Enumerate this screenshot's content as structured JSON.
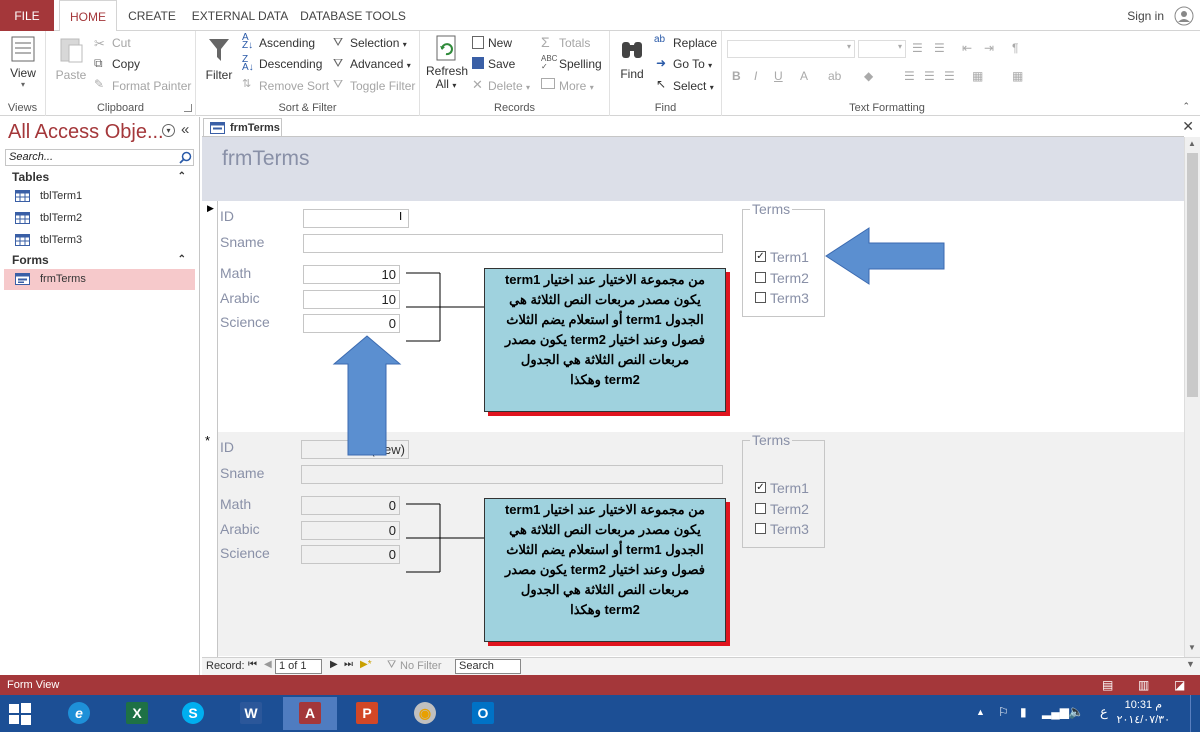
{
  "ribbon_tabs": [
    "FILE",
    "HOME",
    "CREATE",
    "EXTERNAL DATA",
    "DATABASE TOOLS"
  ],
  "signin": "Sign in",
  "groups": {
    "views": {
      "label": "Views",
      "view": "View"
    },
    "clipboard": {
      "label": "Clipboard",
      "paste": "Paste",
      "cut": "Cut",
      "copy": "Copy",
      "format_painter": "Format Painter"
    },
    "sort_filter": {
      "label": "Sort & Filter",
      "filter": "Filter",
      "ascending": "Ascending",
      "descending": "Descending",
      "remove_sort": "Remove Sort",
      "selection": "Selection",
      "advanced": "Advanced",
      "toggle_filter": "Toggle Filter"
    },
    "records": {
      "label": "Records",
      "refresh": "Refresh",
      "refresh2": "All",
      "new": "New",
      "save": "Save",
      "delete": "Delete",
      "totals": "Totals",
      "spelling": "Spelling",
      "more": "More"
    },
    "find": {
      "label": "Find",
      "find": "Find",
      "replace": "Replace",
      "goto": "Go To",
      "select": "Select"
    },
    "text_formatting": {
      "label": "Text Formatting"
    }
  },
  "nav": {
    "title": "All Access Obje...",
    "search_placeholder": "Search...",
    "sections": [
      {
        "title": "Tables",
        "items": [
          "tblTerm1",
          "tblTerm2",
          "tblTerm3"
        ]
      },
      {
        "title": "Forms",
        "items": [
          "frmTerms"
        ]
      }
    ]
  },
  "doc_tab": "frmTerms",
  "form": {
    "title": "frmTerms",
    "labels": {
      "id": "ID",
      "sname": "Sname",
      "math": "Math",
      "arabic": "Arabic",
      "science": "Science"
    },
    "record1": {
      "id": "",
      "sname": "",
      "math": "10",
      "arabic": "10",
      "science": "0"
    },
    "record2": {
      "id": "(New)",
      "sname": "",
      "math": "0",
      "arabic": "0",
      "science": "0"
    },
    "option_group": {
      "title": "Terms",
      "options": [
        "Term1",
        "Term2",
        "Term3"
      ],
      "selected": "Term1"
    },
    "callout_lines": [
      "من مجموعة الاختيار عند اختيار term1",
      "يكون مصدر مربعات النص الثلاثة هي",
      "الجدول term1 أو استعلام يضم الثلاث",
      "فصول وعند اختيار term2 يكون مصدر",
      "مربعات النص الثلاثة هي الجدول",
      "term2 وهكذا"
    ]
  },
  "record_nav": {
    "label": "Record:",
    "position": "1 of 1",
    "no_filter": "No Filter",
    "search": "Search"
  },
  "status": "Form View",
  "clock": {
    "time": "10:31 م",
    "date": "٢٠١٤/٠٧/٣٠"
  },
  "taskbar_lang": "ع",
  "colors": {
    "accent": "#a4373a",
    "taskbar": "#1c4f95",
    "callout_fill": "#9fd2de",
    "callout_shadow": "#e0141e",
    "arrow": "#5b8fd0"
  }
}
